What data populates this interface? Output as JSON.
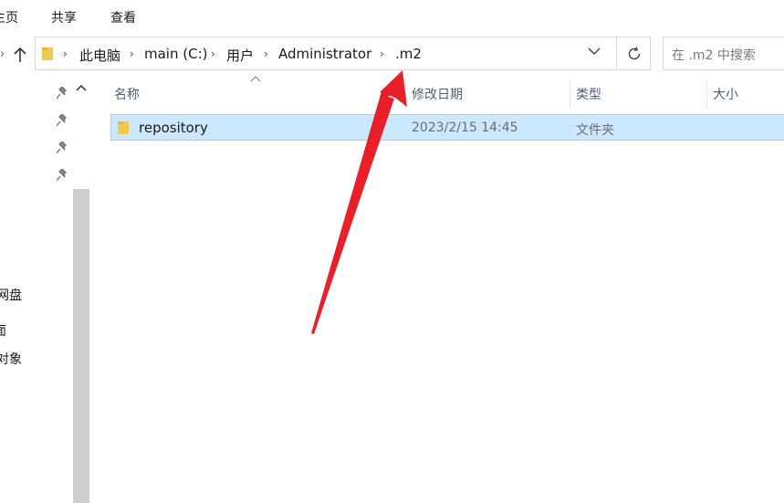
{
  "ribbon": {
    "tabs": [
      {
        "label": "主页"
      },
      {
        "label": "共享"
      },
      {
        "label": "查看"
      }
    ]
  },
  "address": {
    "crumbs": [
      "此电脑",
      "main (C:)",
      "用户",
      "Administrator",
      ".m2"
    ]
  },
  "search": {
    "placeholder": "在 .m2 中搜索"
  },
  "nav_pane": {
    "items": [
      "网盘",
      "面",
      "对象"
    ]
  },
  "columns": {
    "name": "名称",
    "modified": "修改日期",
    "type": "类型",
    "size": "大小"
  },
  "files": [
    {
      "name": "repository",
      "modified": "2023/2/15 14:45",
      "type": "文件夹",
      "size": "",
      "selected": true
    }
  ],
  "colors": {
    "selection_bg": "#cce8ff",
    "selection_border": "#99d1ff",
    "folder": "#f2c94c",
    "annotation_arrow": "#e8202a"
  }
}
